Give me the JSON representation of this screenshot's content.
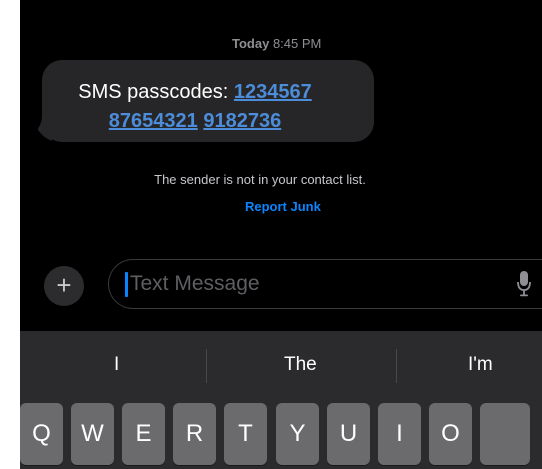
{
  "conversation": {
    "timestamp_day": "Today",
    "timestamp_time": "8:45 PM",
    "message_prefix": "SMS passcodes: ",
    "codes": [
      "1234567",
      "87654321",
      "9182736"
    ],
    "sender_notice": "The sender is not in your contact list.",
    "report_junk_label": "Report Junk"
  },
  "composer": {
    "plus_label": "+",
    "placeholder": "Text Message"
  },
  "keyboard": {
    "suggestions": [
      "I",
      "The",
      "I'm"
    ],
    "top_row": [
      "Q",
      "W",
      "E",
      "R",
      "T",
      "Y",
      "U",
      "I",
      "O"
    ]
  },
  "colors": {
    "background": "#000000",
    "bubble": "#262628",
    "link": "#4c8cd8",
    "accent": "#0a84ff",
    "key": "#6b6b6e"
  }
}
